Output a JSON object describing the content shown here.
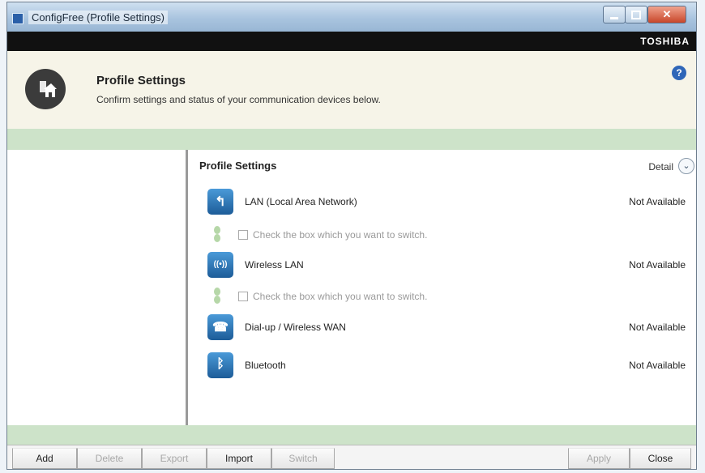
{
  "window": {
    "title": "ConfigFree (Profile Settings)",
    "min_icon": "minimize-icon",
    "max_icon": "maximize-icon",
    "close_icon": "close-icon",
    "close_glyph": "✕"
  },
  "brand": "TOSHIBA",
  "header": {
    "title": "Profile Settings",
    "subtitle": "Confirm settings and status of your communication devices below.",
    "help_glyph": "?"
  },
  "main": {
    "title": "Profile Settings",
    "detail_label": "Detail",
    "detail_glyph": "⌄",
    "devices": [
      {
        "label": "LAN (Local Area Network)",
        "status": "Not Available",
        "icon": "lan-icon",
        "glyph": "↰"
      },
      {
        "label": "Wireless LAN",
        "status": "Not Available",
        "icon": "wireless-lan-icon",
        "glyph": "((•))"
      },
      {
        "label": "Dial-up / Wireless WAN",
        "status": "Not Available",
        "icon": "dialup-wan-icon",
        "glyph": "☎"
      },
      {
        "label": "Bluetooth",
        "status": "Not Available",
        "icon": "bluetooth-icon",
        "glyph": "ᛒ"
      }
    ],
    "switch_rows": [
      {
        "text": "Check the box which you want to switch."
      },
      {
        "text": "Check the box which you want to switch."
      }
    ]
  },
  "footer": {
    "buttons": [
      {
        "label": "Add",
        "enabled": true
      },
      {
        "label": "Delete",
        "enabled": false
      },
      {
        "label": "Export",
        "enabled": false
      },
      {
        "label": "Import",
        "enabled": true
      },
      {
        "label": "Switch",
        "enabled": false
      },
      {
        "label": "Apply",
        "enabled": false
      },
      {
        "label": "Close",
        "enabled": true
      }
    ]
  },
  "colors": {
    "header_bg": "#f6f4e8",
    "band_green": "#cde3c9",
    "brand_bar": "#111111",
    "accent_blue": "#2f66b8"
  }
}
